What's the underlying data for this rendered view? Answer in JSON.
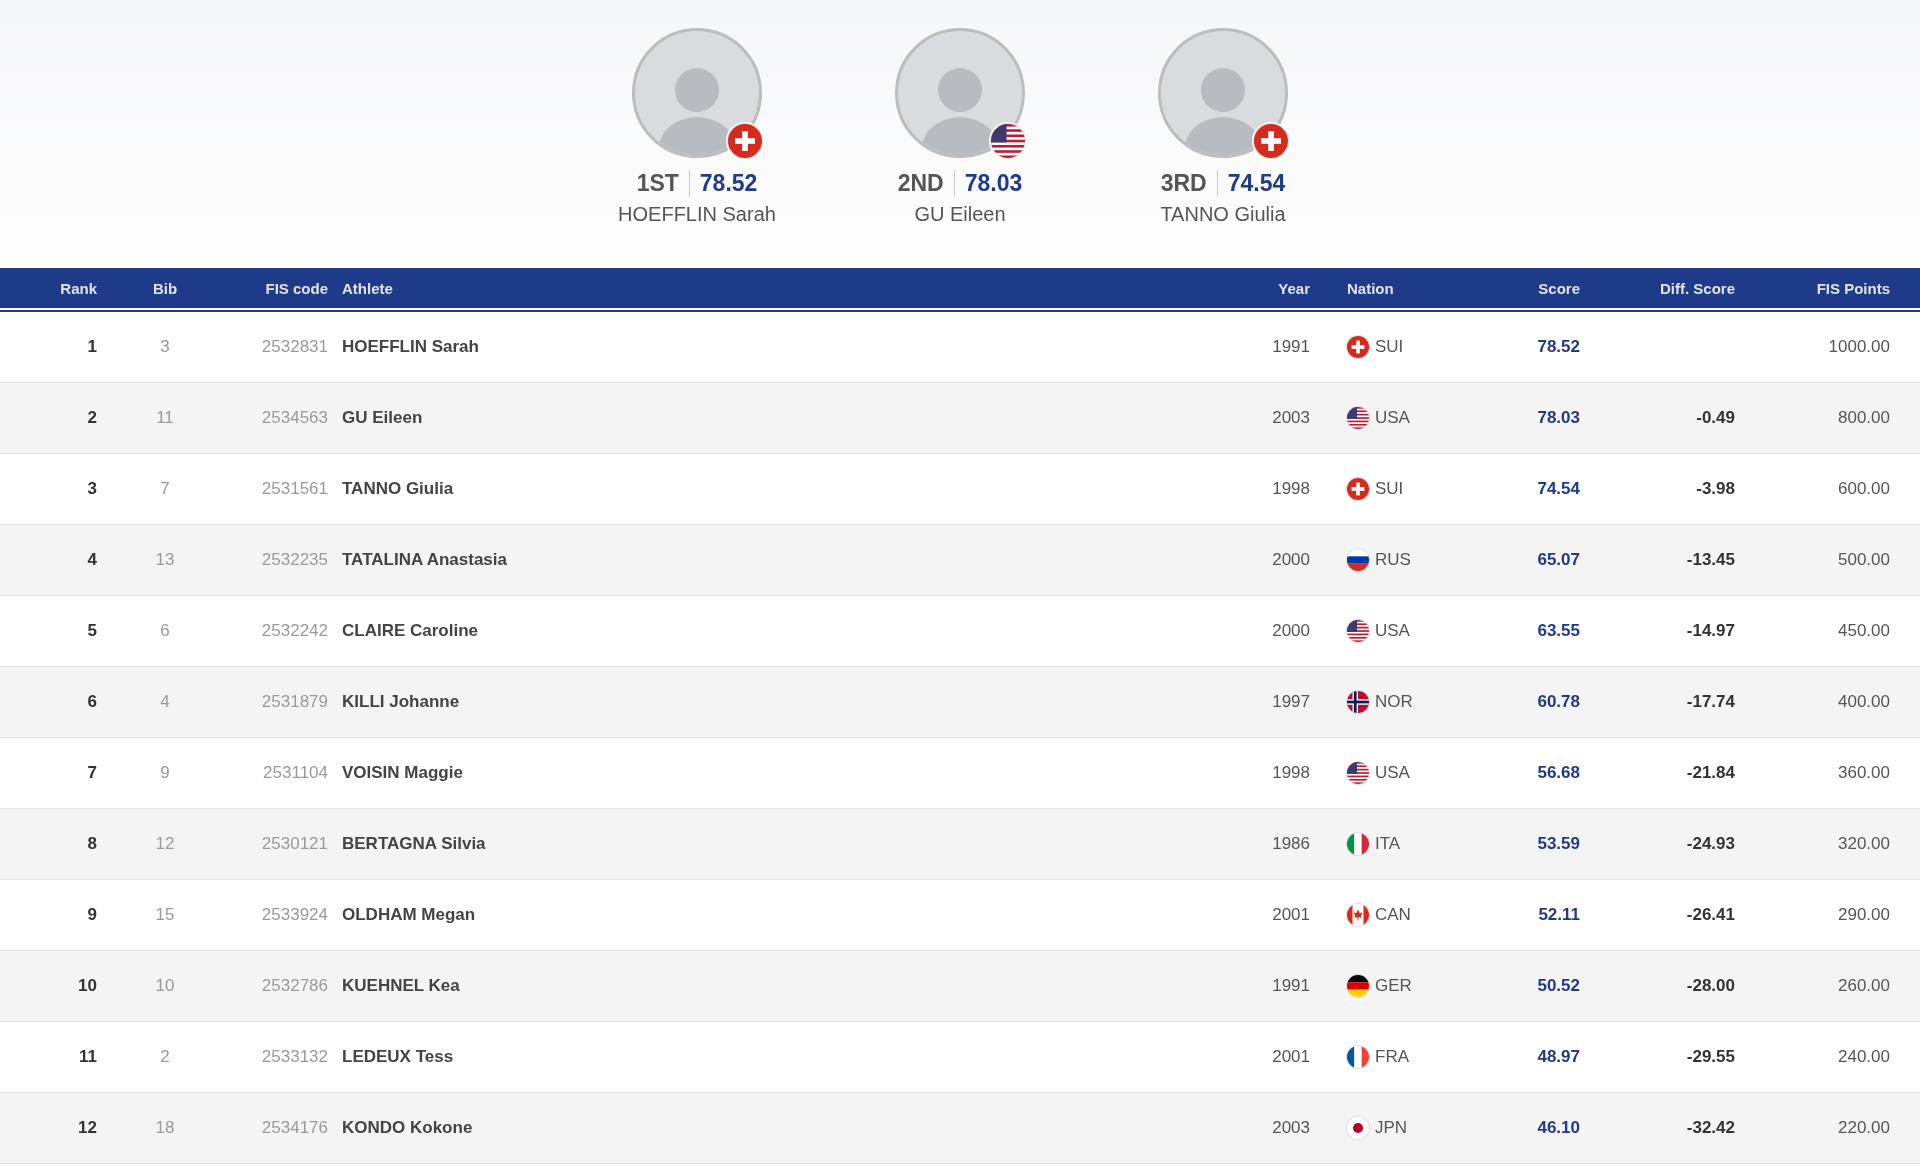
{
  "podium": [
    {
      "place": "1ST",
      "score": "78.52",
      "name": "HOEFFLIN Sarah",
      "kind": "ch"
    },
    {
      "place": "2ND",
      "score": "78.03",
      "name": "GU Eileen",
      "kind": "us"
    },
    {
      "place": "3RD",
      "score": "74.54",
      "name": "TANNO Giulia",
      "kind": "ch"
    }
  ],
  "table": {
    "columns": [
      "Rank",
      "Bib",
      "FIS code",
      "Athlete",
      "Year",
      "Nation",
      "Score",
      "Diff. Score",
      "FIS Points"
    ],
    "rows": [
      {
        "rank": "1",
        "bib": "3",
        "fis_code": "2532831",
        "athlete": "HOEFFLIN Sarah",
        "year": "1991",
        "kind": "ch",
        "nation": "SUI",
        "score": "78.52",
        "fis_points": "1000.00"
      },
      {
        "rank": "2",
        "bib": "11",
        "fis_code": "2534563",
        "athlete": "GU Eileen",
        "year": "2003",
        "kind": "us",
        "nation": "USA",
        "score": "78.03",
        "diff_score": "-0.49",
        "fis_points": "800.00"
      },
      {
        "rank": "3",
        "bib": "7",
        "fis_code": "2531561",
        "athlete": "TANNO Giulia",
        "year": "1998",
        "kind": "ch",
        "nation": "SUI",
        "score": "74.54",
        "diff_score": "-3.98",
        "fis_points": "600.00"
      },
      {
        "rank": "4",
        "bib": "13",
        "fis_code": "2532235",
        "athlete": "TATALINA Anastasia",
        "year": "2000",
        "kind": "ru",
        "nation": "RUS",
        "score": "65.07",
        "diff_score": "-13.45",
        "fis_points": "500.00"
      },
      {
        "rank": "5",
        "bib": "6",
        "fis_code": "2532242",
        "athlete": "CLAIRE Caroline",
        "year": "2000",
        "kind": "us",
        "nation": "USA",
        "score": "63.55",
        "diff_score": "-14.97",
        "fis_points": "450.00"
      },
      {
        "rank": "6",
        "bib": "4",
        "fis_code": "2531879",
        "athlete": "KILLI Johanne",
        "year": "1997",
        "kind": "no",
        "nation": "NOR",
        "score": "60.78",
        "diff_score": "-17.74",
        "fis_points": "400.00"
      },
      {
        "rank": "7",
        "bib": "9",
        "fis_code": "2531104",
        "athlete": "VOISIN Maggie",
        "year": "1998",
        "kind": "us",
        "nation": "USA",
        "score": "56.68",
        "diff_score": "-21.84",
        "fis_points": "360.00"
      },
      {
        "rank": "8",
        "bib": "12",
        "fis_code": "2530121",
        "athlete": "BERTAGNA Silvia",
        "year": "1986",
        "kind": "it",
        "nation": "ITA",
        "score": "53.59",
        "diff_score": "-24.93",
        "fis_points": "320.00"
      },
      {
        "rank": "9",
        "bib": "15",
        "fis_code": "2533924",
        "athlete": "OLDHAM Megan",
        "year": "2001",
        "kind": "ca",
        "nation": "CAN",
        "score": "52.11",
        "diff_score": "-26.41",
        "fis_points": "290.00"
      },
      {
        "rank": "10",
        "bib": "10",
        "fis_code": "2532786",
        "athlete": "KUEHNEL Kea",
        "year": "1991",
        "kind": "de",
        "nation": "GER",
        "score": "50.52",
        "diff_score": "-28.00",
        "fis_points": "260.00"
      },
      {
        "rank": "11",
        "bib": "2",
        "fis_code": "2533132",
        "athlete": "LEDEUX Tess",
        "year": "2001",
        "kind": "fr",
        "nation": "FRA",
        "score": "48.97",
        "diff_score": "-29.55",
        "fis_points": "240.00"
      },
      {
        "rank": "12",
        "bib": "18",
        "fis_code": "2534176",
        "athlete": "KONDO Kokone",
        "year": "2003",
        "kind": "jp",
        "nation": "JPN",
        "score": "46.10",
        "diff_score": "-32.42",
        "fis_points": "220.00"
      }
    ]
  }
}
